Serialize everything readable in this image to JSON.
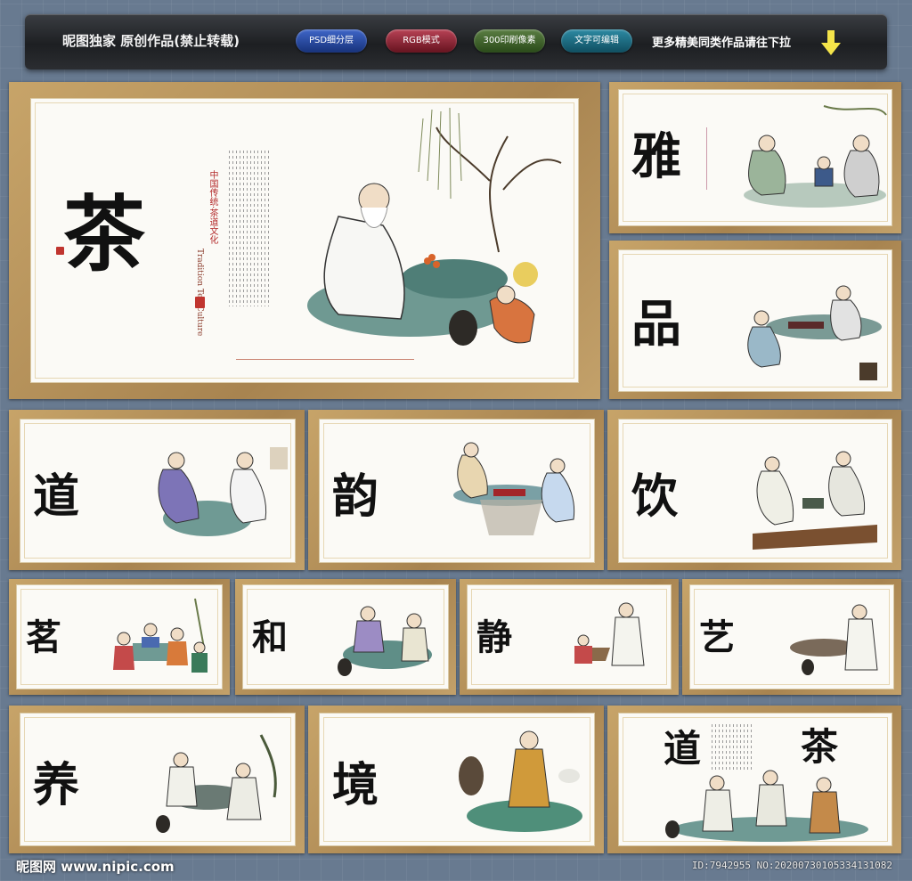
{
  "header": {
    "title": "昵图独家 原创作品(禁止转载)",
    "badges": [
      "PSD细分层",
      "RGB模式",
      "300印刷像素",
      "文字可编辑"
    ],
    "more_text": "更多精美同类作品请往下拉",
    "arrow_icon": "down-arrow-icon"
  },
  "main_panel": {
    "char": "茶",
    "vertical_title": "中国传统·茶道文化",
    "english": "Tradition Tea Culture",
    "seal_text": "茶韵"
  },
  "panels": [
    {
      "char": "雅"
    },
    {
      "char": "品"
    },
    {
      "char": "道"
    },
    {
      "char": "韵"
    },
    {
      "char": "饮"
    },
    {
      "char": "茗"
    },
    {
      "char": "和"
    },
    {
      "char": "静"
    },
    {
      "char": "艺"
    },
    {
      "char": "养"
    },
    {
      "char": "境"
    },
    {
      "char": "道",
      "char2": "茶"
    }
  ],
  "footer": {
    "logo": "昵图网 www.nipic.com",
    "id_text": "ID:7942955 NO:20200730105334131082"
  },
  "colors": {
    "frame": "#c7a469",
    "background": "#687a90",
    "seal": "#c0352f"
  }
}
